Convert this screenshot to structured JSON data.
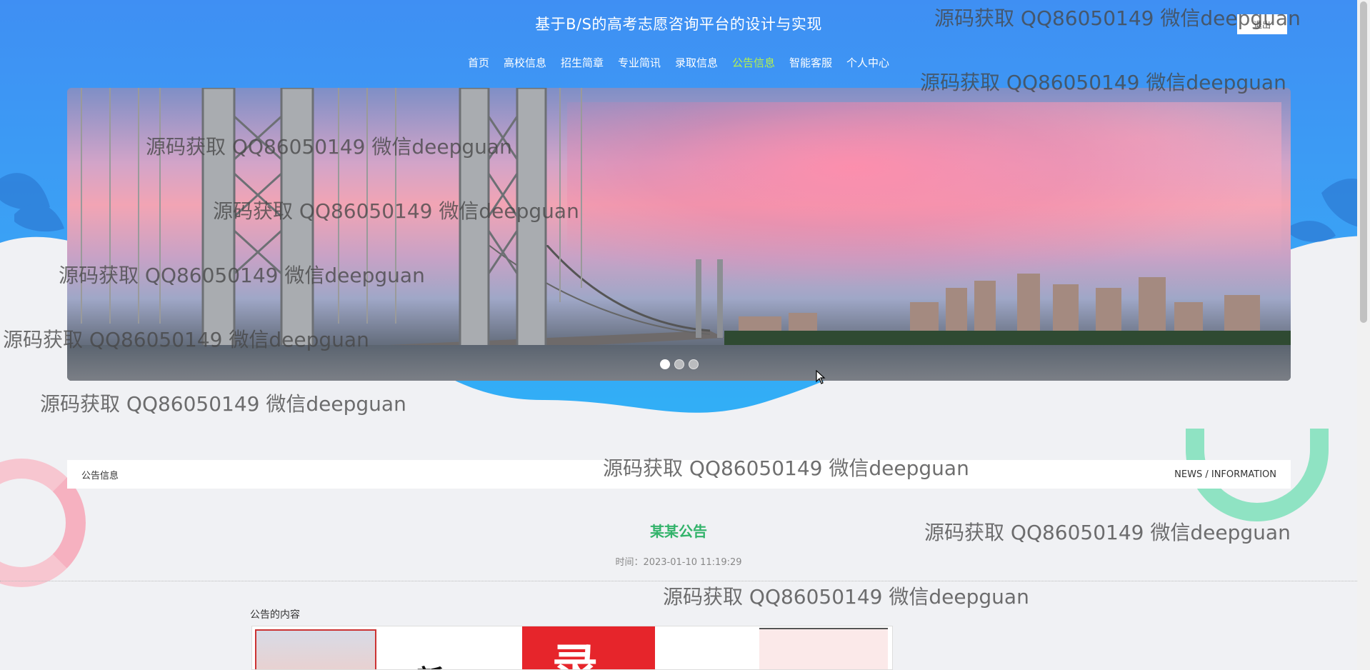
{
  "header": {
    "title": "基于B/S的高考志愿咨询平台的设计与实现",
    "logout_label": "退出"
  },
  "nav": {
    "items": [
      {
        "label": "首页"
      },
      {
        "label": "高校信息"
      },
      {
        "label": "招生简章"
      },
      {
        "label": "专业简讯"
      },
      {
        "label": "录取信息"
      },
      {
        "label": "公告信息"
      },
      {
        "label": "智能客服"
      },
      {
        "label": "个人中心"
      }
    ],
    "active_color": "#b6f24a"
  },
  "banner": {
    "slide_count": 3,
    "active_slide": 1
  },
  "news_bar": {
    "left_label": "公告信息",
    "right_label": "NEWS / INFORMATION"
  },
  "article": {
    "title": "某某公告",
    "time": "时间：2023-01-10 11:19:29",
    "content_label": "公告的内容",
    "image_char": "录",
    "image_text": "新",
    "title_color": "#32b36a"
  },
  "watermark": {
    "text": "源码获取 QQ86050149 微信deepguan"
  },
  "colors": {
    "header_blue": "#3f8ff3",
    "accent_green": "#32b36a"
  }
}
